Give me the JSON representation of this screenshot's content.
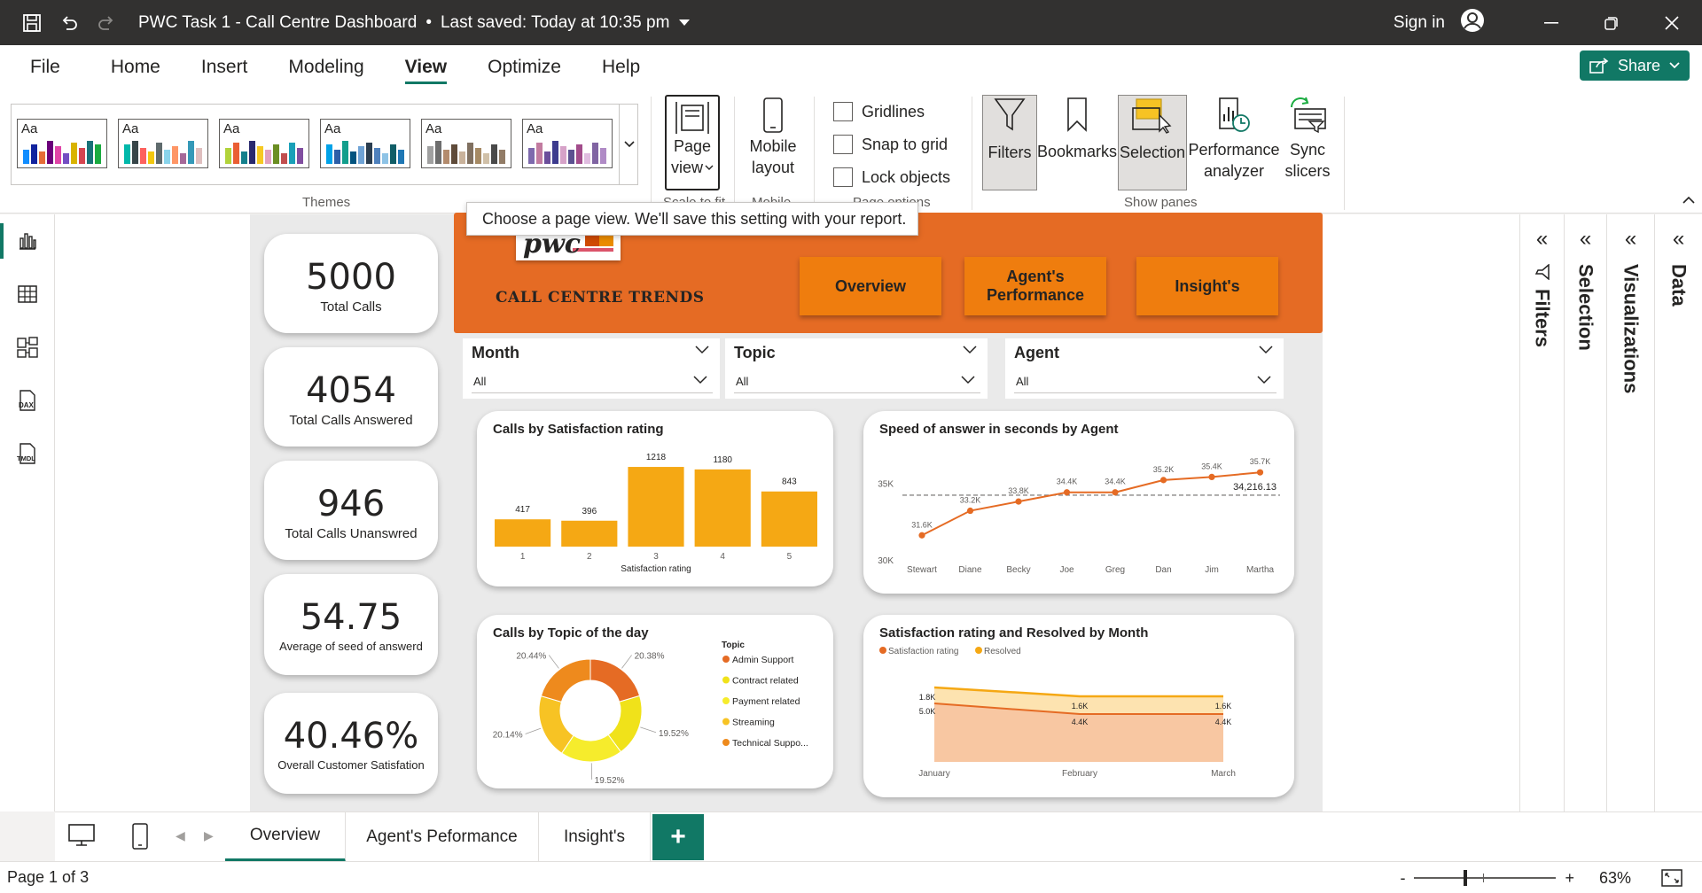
{
  "window": {
    "title": "PWC Task 1 - Call Centre Dashboard",
    "saved": "Last saved: Today at 10:35 pm",
    "separator": "•",
    "sign_in": "Sign in"
  },
  "ribbon_tabs": [
    "File",
    "Home",
    "Insert",
    "Modeling",
    "View",
    "Optimize",
    "Help"
  ],
  "active_tab": "View",
  "share_label": "Share",
  "ribbon": {
    "themes_label": "Themes",
    "theme_aa": "Aa",
    "page_view_line1": "Page",
    "page_view_line2": "view",
    "scale_group": "Scale to fit",
    "mobile_line1": "Mobile",
    "mobile_line2": "layout",
    "mobile_group": "Mobile",
    "gridlines": "Gridlines",
    "snap": "Snap to grid",
    "lock": "Lock objects",
    "page_options_group": "Page options",
    "filters": "Filters",
    "bookmarks": "Bookmarks",
    "selection": "Selection",
    "perf_line1": "Performance",
    "perf_line2": "analyzer",
    "sync_line1": "Sync",
    "sync_line2": "slicers",
    "show_panes_group": "Show panes"
  },
  "tooltip": "Choose a page view. We'll save this setting with your report.",
  "report": {
    "banner_title": "CALL CENTRE TRENDS",
    "logo_text": "pwc",
    "nav": {
      "overview": "Overview",
      "agents_line1": "Agent's",
      "agents_line2": "Performance",
      "insights": "Insight's"
    },
    "kpis": [
      {
        "value": "5000",
        "label": "Total Calls"
      },
      {
        "value": "4054",
        "label": "Total Calls Answered"
      },
      {
        "value": "946",
        "label": "Total Calls Unanswred"
      },
      {
        "value": "54.75",
        "label": "Average of seed of answerd"
      },
      {
        "value": "40.46%",
        "label": "Overall Customer Satisfation"
      }
    ],
    "slicers": [
      {
        "title": "Month",
        "value": "All"
      },
      {
        "title": "Topic",
        "value": "All"
      },
      {
        "title": "Agent",
        "value": "All"
      }
    ]
  },
  "chart_data": [
    {
      "type": "bar",
      "title": "Calls by Satisfaction rating",
      "xlabel": "Satisfaction rating",
      "categories": [
        "1",
        "2",
        "3",
        "4",
        "5"
      ],
      "values": [
        417,
        396,
        1218,
        1180,
        843
      ],
      "value_labels": [
        "417",
        "396",
        "1218",
        "1180",
        "843"
      ],
      "color": "#f5a814",
      "ylim": [
        0,
        1300
      ]
    },
    {
      "type": "line",
      "title": "Speed of answer in seconds by Agent",
      "categories": [
        "Stewart",
        "Diane",
        "Becky",
        "Joe",
        "Greg",
        "Dan",
        "Jim",
        "Martha"
      ],
      "values": [
        31600,
        33200,
        33800,
        34400,
        34400,
        35200,
        35400,
        35700
      ],
      "value_labels": [
        "31.6K",
        "33.2K",
        "33.8K",
        "34.4K",
        "34.4K",
        "35.2K",
        "35.4K",
        "35.7K"
      ],
      "y_ticks": [
        "35K",
        "30K"
      ],
      "reference_value": 34216.13,
      "reference_label": "34,216.13",
      "ylim": [
        30000,
        36000
      ],
      "color": "#e56b24"
    },
    {
      "type": "pie",
      "title": "Calls by Topic of the day",
      "legend_title": "Topic",
      "labels": [
        "Admin Support",
        "Contract related",
        "Payment related",
        "Streaming",
        "Technical Suppo..."
      ],
      "values": [
        20.38,
        19.52,
        19.52,
        20.14,
        20.44
      ],
      "value_labels": [
        "20.38%",
        "19.52%",
        "19.52%",
        "20.14%",
        "20.44%"
      ],
      "colors": [
        "#e56b24",
        "#f0e21a",
        "#f6ec2c",
        "#f7c324",
        "#ee8a1d"
      ]
    },
    {
      "type": "area",
      "title": "Satisfaction rating and Resolved by Month",
      "categories": [
        "January",
        "February",
        "March"
      ],
      "series": [
        {
          "name": "Satisfaction rating",
          "values": [
            1800,
            1600,
            1600
          ],
          "value_labels": [
            "1.8K",
            "1.6K",
            "1.6K"
          ],
          "color": "#f5a814"
        },
        {
          "name": "Resolved",
          "values": [
            5000,
            4400,
            4400
          ],
          "value_labels": [
            "5.0K",
            "4.4K",
            "4.4K"
          ],
          "color": "#f7c324"
        }
      ]
    }
  ],
  "panes": [
    "Filters",
    "Selection",
    "Visualizations",
    "Data"
  ],
  "page_tabs": [
    "Overview",
    "Agent's Peformance",
    "Insight's"
  ],
  "status": {
    "page": "Page 1 of 3",
    "zoom": "63%",
    "minus": "-",
    "plus": "+"
  }
}
